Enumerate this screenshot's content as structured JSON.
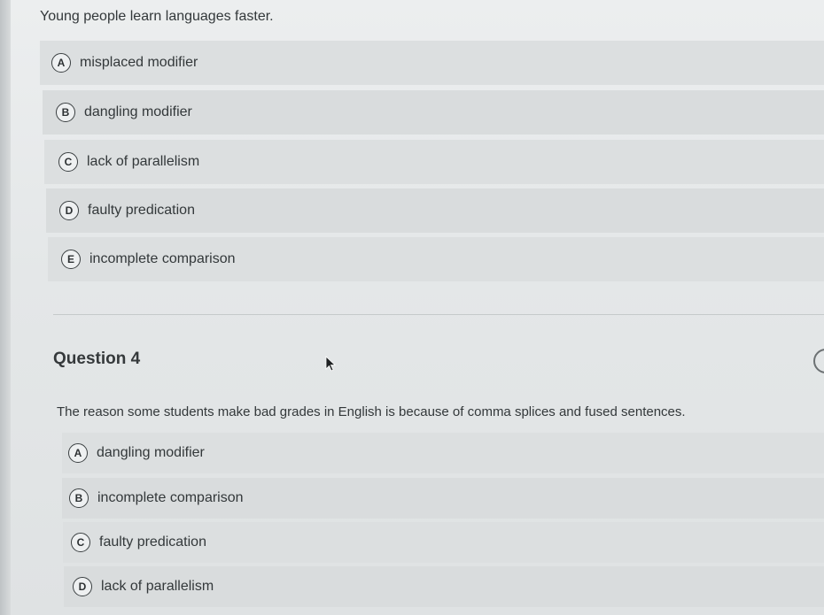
{
  "question3": {
    "prompt": "Young people learn languages faster.",
    "options": [
      {
        "letter": "A",
        "label": "misplaced modifier"
      },
      {
        "letter": "B",
        "label": "dangling modifier"
      },
      {
        "letter": "C",
        "label": "lack of parallelism"
      },
      {
        "letter": "D",
        "label": "faulty predication"
      },
      {
        "letter": "E",
        "label": "incomplete comparison"
      }
    ]
  },
  "question4": {
    "heading": "Question 4",
    "prompt": "The reason some students make bad grades in English is because of comma splices and fused sentences.",
    "options": [
      {
        "letter": "A",
        "label": "dangling modifier"
      },
      {
        "letter": "B",
        "label": "incomplete comparison"
      },
      {
        "letter": "C",
        "label": "faulty predication"
      },
      {
        "letter": "D",
        "label": "lack of parallelism"
      }
    ]
  },
  "icons": {
    "cursor": "mouse-pointer-icon",
    "side_control": "circle-outline-icon"
  },
  "colors": {
    "option_background": "#dcdfe0",
    "page_background": "#e6e9ea",
    "text": "#33383a"
  }
}
